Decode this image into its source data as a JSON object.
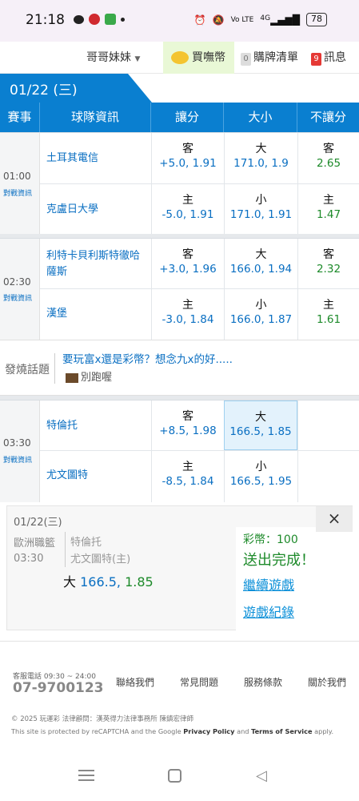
{
  "status_bar": {
    "time": "21:18",
    "signal": "4G",
    "battery": "78"
  },
  "top_nav": {
    "user": "哥哥妹妹",
    "buy_coins": "買嘸幣",
    "cart_count": "0",
    "cart_label": "購牌清單",
    "msg_count": "9",
    "msg_label": "訊息"
  },
  "date_tab": "01/22 (三)",
  "table_headers": [
    "賽事",
    "球隊資訊",
    "讓分",
    "大小",
    "不讓分"
  ],
  "matches": [
    {
      "time": "01:00",
      "info": "對戰資訊",
      "away": {
        "team": "土耳其電信",
        "spread_label": "客",
        "spread": "+5.0, 1.91",
        "ou_label": "大",
        "ou": "171.0, 1.9",
        "ml_label": "客",
        "ml": "2.65"
      },
      "home": {
        "team": "克盧日大學",
        "spread_label": "主",
        "spread": "-5.0, 1.91",
        "ou_label": "小",
        "ou": "171.0, 1.91",
        "ml_label": "主",
        "ml": "1.47"
      }
    },
    {
      "time": "02:30",
      "info": "對戰資訊",
      "away": {
        "team": "利特卡貝利斯特徹哈薩斯",
        "team_line1": "利特卡貝利斯特徹哈",
        "team_line2": "薩斯",
        "spread_label": "客",
        "spread": "+3.0, 1.96",
        "ou_label": "大",
        "ou": "166.0, 1.94",
        "ml_label": "客",
        "ml": "2.32"
      },
      "home": {
        "team": "漢堡",
        "spread_label": "主",
        "spread": "-3.0, 1.84",
        "ou_label": "小",
        "ou": "166.0, 1.87",
        "ml_label": "主",
        "ml": "1.61"
      }
    },
    {
      "time": "03:30",
      "info": "對戰資訊",
      "away": {
        "team": "特倫托",
        "spread_label": "客",
        "spread": "+8.5, 1.98",
        "ou_label": "大",
        "ou": "166.5, 1.85"
      },
      "home": {
        "team": "尤文圖特",
        "spread_label": "主",
        "spread": "-8.5, 1.84",
        "ou_label": "小",
        "ou": "166.5, 1.95"
      }
    }
  ],
  "hot_topic": {
    "label": "發燒話題",
    "title": "要玩富x還是彩幣？想念九x的好.....",
    "author": "別跑喔"
  },
  "bet_popup": {
    "date": "01/22(三)",
    "league": "歐洲職籃",
    "time": "03:30",
    "team_away": "特倫托",
    "team_home": "尤文圖特(主)",
    "pick_label": "大",
    "pick_line": "166.5,",
    "pick_odds": "1.85",
    "coins": "彩幣：100",
    "success": "送出完成！",
    "continue": "繼續遊戲",
    "history": "遊戲紀錄",
    "close": "×"
  },
  "footer": {
    "hotline_label": "客服電話 09:30 ~ 24:00",
    "hotline": "07-9700123",
    "links": [
      "聯絡我們",
      "常見問題",
      "服務條款",
      "關於我們"
    ],
    "copyright": "© 2025 玩運彩 法律顧問：漢英得力法律事務所 陳鎮宏律師",
    "recaptcha_pre": "This site is protected by reCAPTCHA and the Google ",
    "privacy": "Privacy Policy",
    "and": " and ",
    "terms": "Terms of Service",
    "apply": " apply."
  },
  "colors": {
    "brand_blue": "#0a7fd0",
    "odds_green": "#1d8a2a",
    "odds_blue": "#0a6fc2",
    "selected_bg": "#e3f2fc"
  }
}
